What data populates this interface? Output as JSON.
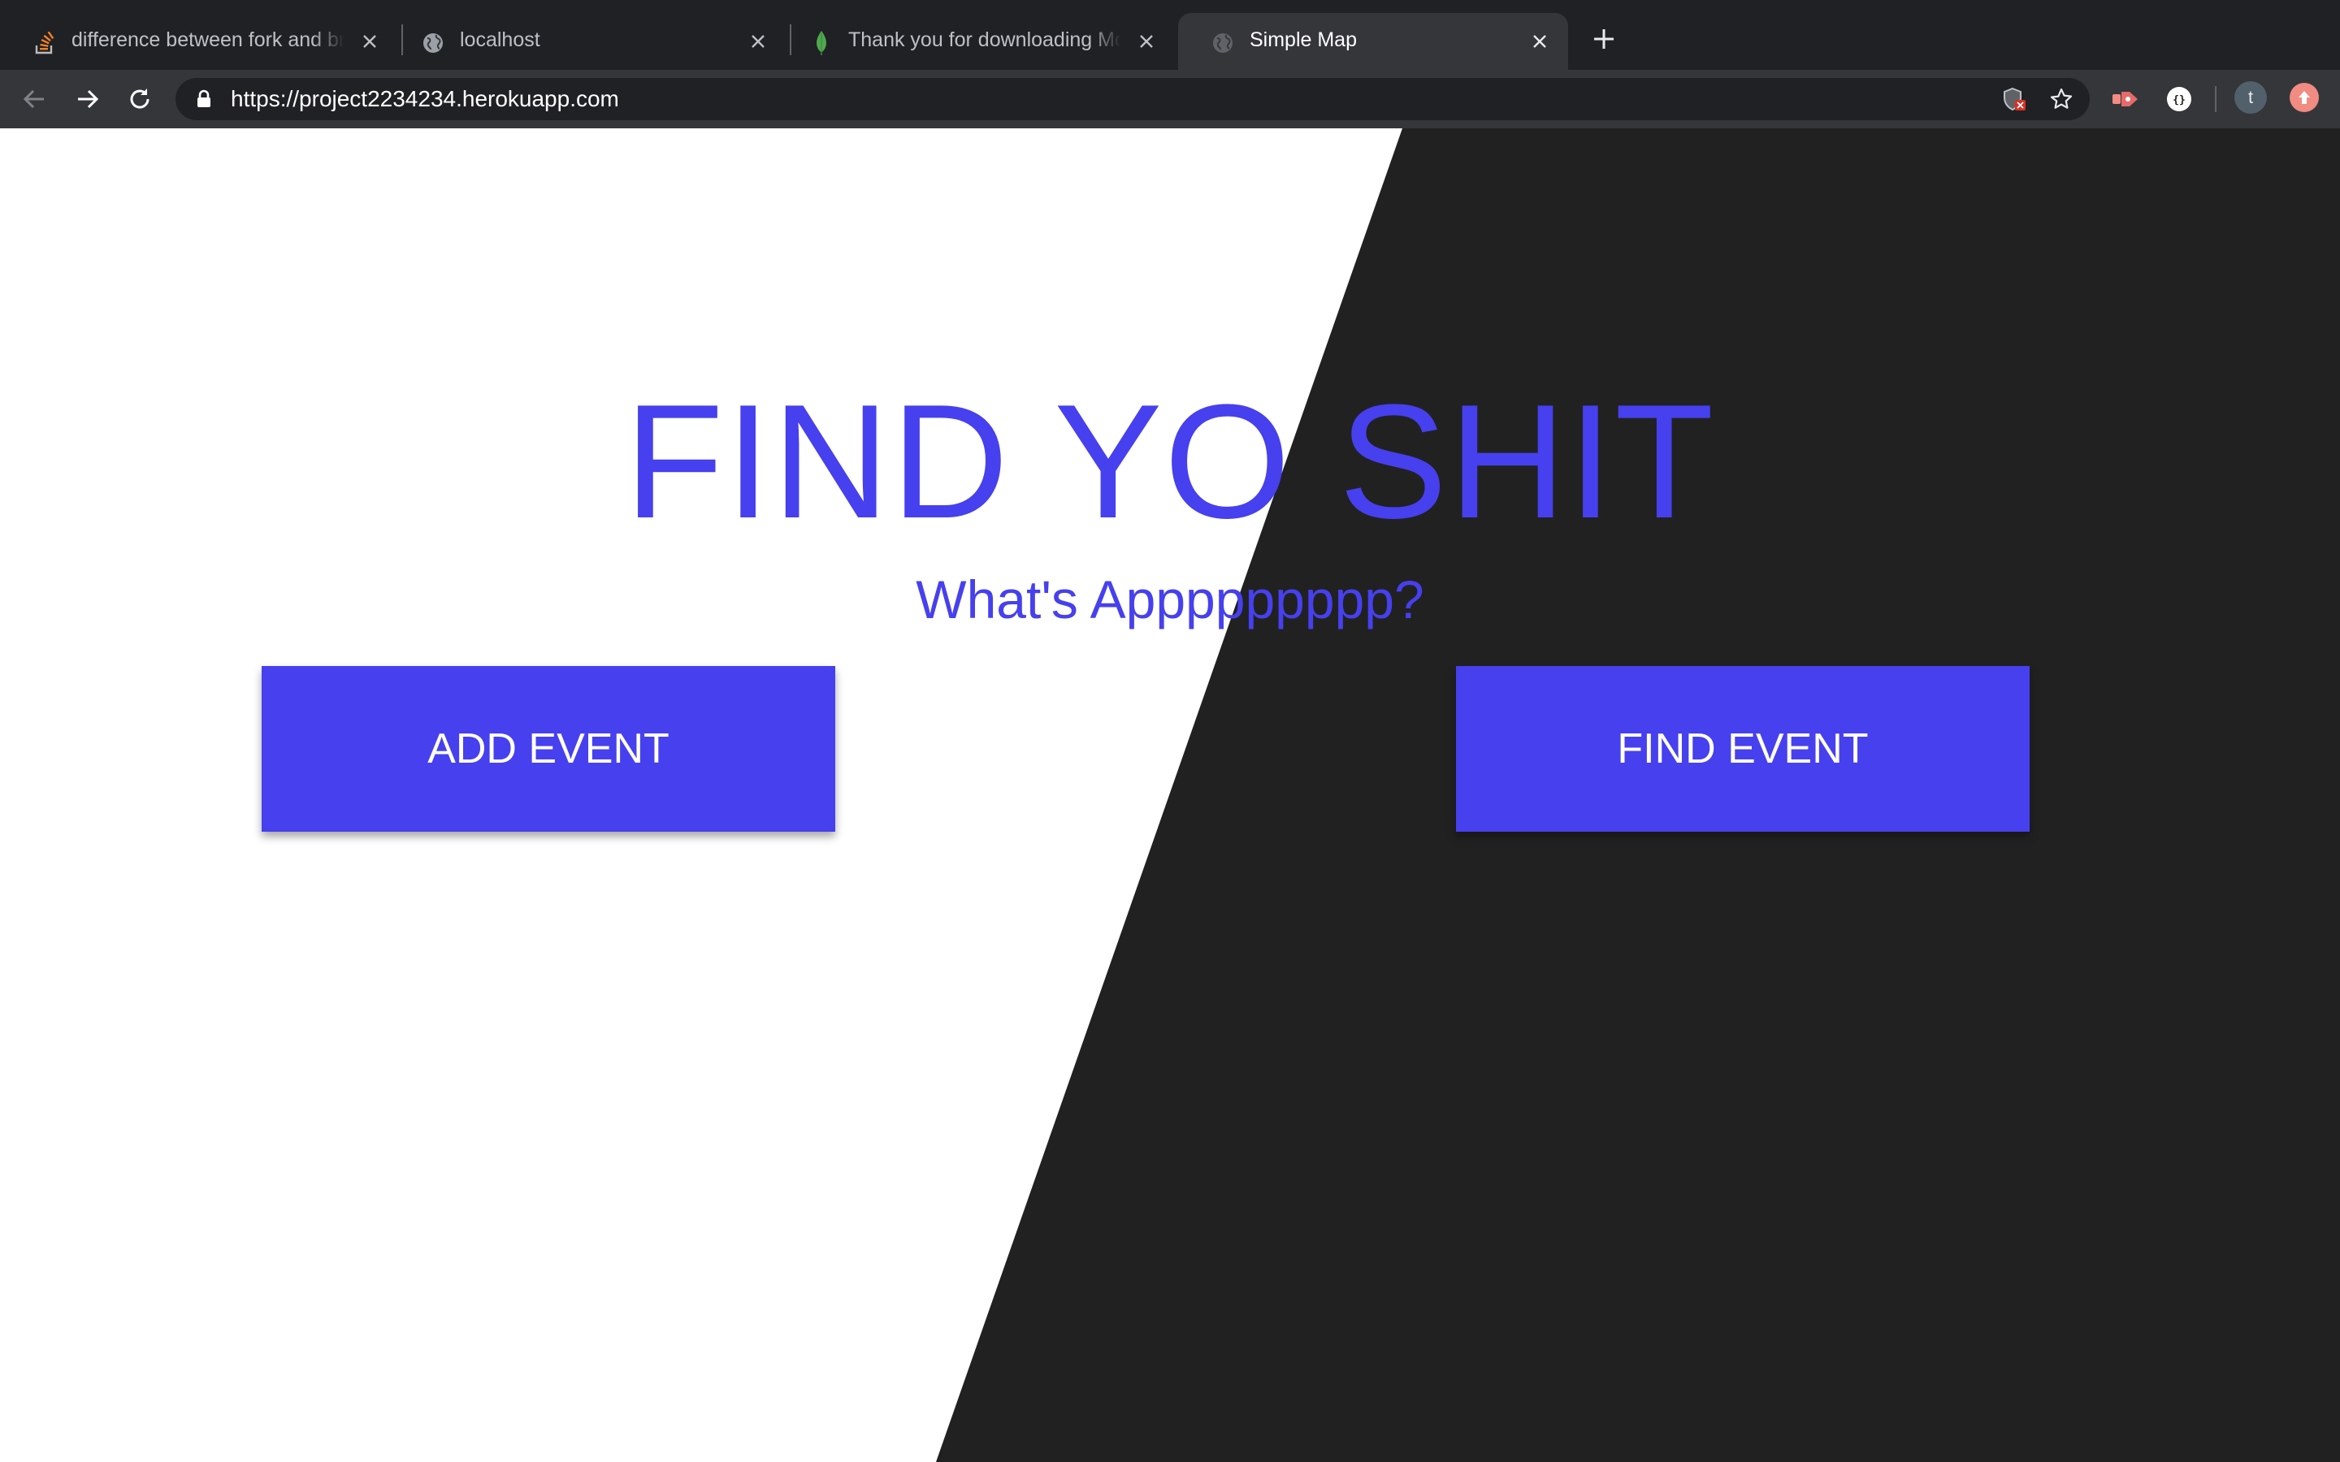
{
  "browser": {
    "tabs": [
      {
        "title": "difference between fork and branch on github - Stack Overflow",
        "icon": "stackoverflow-icon"
      },
      {
        "title": "localhost",
        "icon": "globe-icon"
      },
      {
        "title": "Thank you for downloading MongoDB",
        "icon": "mongodb-leaf-icon"
      },
      {
        "title": "Simple Map",
        "icon": "globe-icon",
        "active": true
      }
    ],
    "url": "https://project2234234.herokuapp.com",
    "profile_initial": "t"
  },
  "page": {
    "title": "FIND YO SHIT",
    "subtitle": "What's Appppppppp?",
    "add_button": "ADD EVENT",
    "find_button": "FIND EVENT"
  },
  "colors": {
    "accent": "#4640ee",
    "dark_panel": "#212121",
    "page_background": "#ffffff",
    "button_text": "#ffffff"
  }
}
